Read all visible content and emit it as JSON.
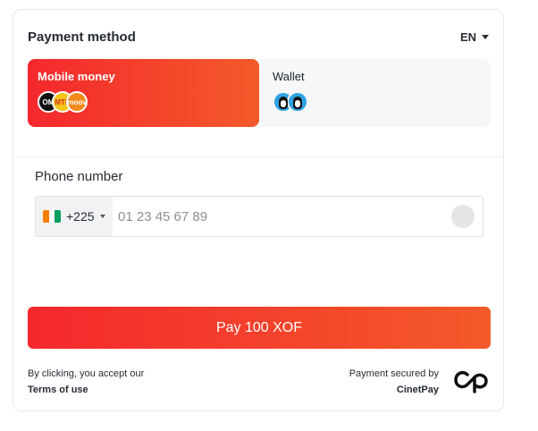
{
  "header": {
    "title": "Payment method",
    "language": "EN"
  },
  "methods": [
    {
      "label": "Mobile money",
      "selected": true,
      "logos": [
        "orange-money-logo",
        "mtn-money-logo",
        "moov-money-logo"
      ],
      "logo_text": [
        "OM",
        "MTN",
        "moov"
      ]
    },
    {
      "label": "Wallet",
      "selected": false,
      "logos": [
        "wallet-penguin-logo",
        "wallet-penguin-logo"
      ]
    }
  ],
  "phone": {
    "label": "Phone number",
    "country_code": "+225",
    "country": "CI",
    "placeholder": "01 23 45 67 89",
    "value": ""
  },
  "pay_button": {
    "label": "Pay 100 XOF"
  },
  "footer": {
    "consent_text": "By clicking, you accept our",
    "terms_link": "Terms of use",
    "secured_text": "Payment secured by",
    "brand": "CinetPay"
  },
  "colors": {
    "accent_start": "#f5282d",
    "accent_end": "#f35a2a",
    "wallet_bg": "#f5f7f9"
  }
}
